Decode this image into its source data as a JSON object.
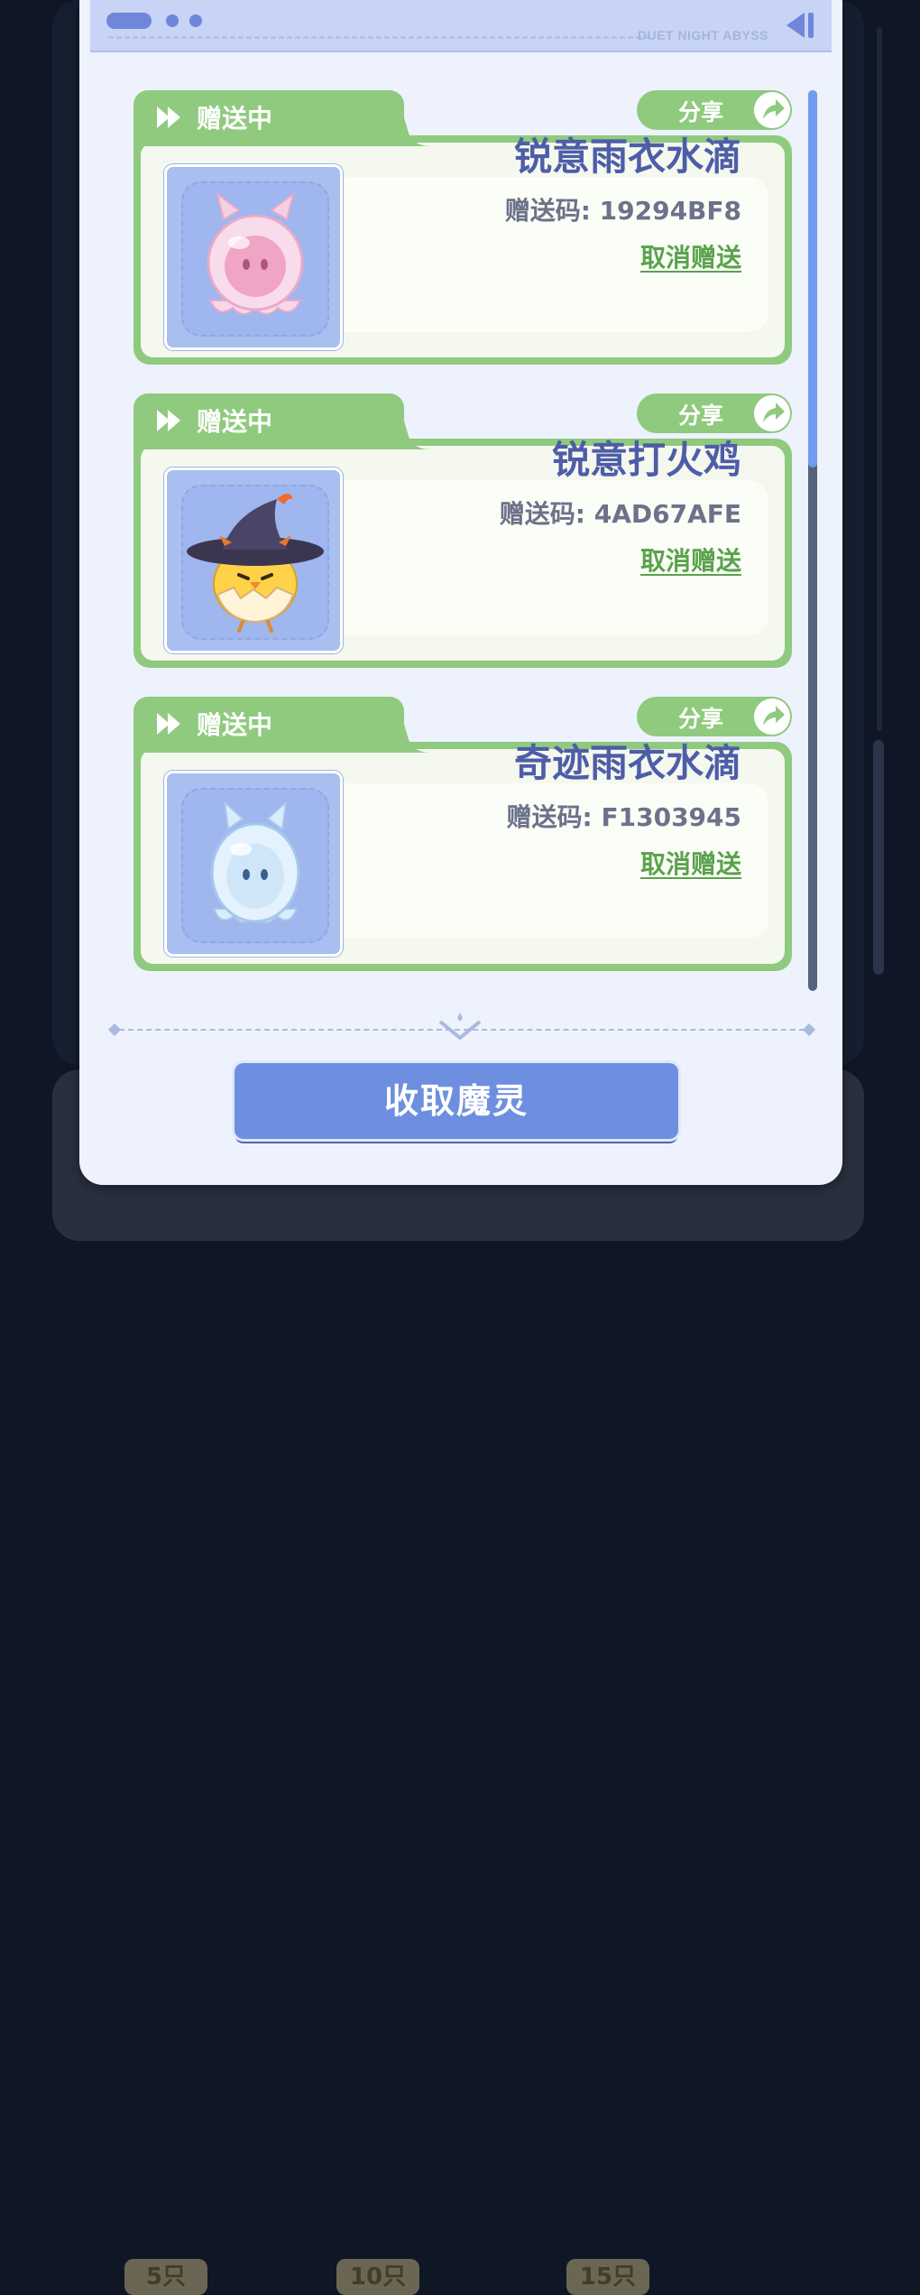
{
  "header": {
    "brand": "DUET NIGHT ABYSS"
  },
  "gifts": [
    {
      "status": "赠送中",
      "share_label": "分享",
      "name": "锐意雨衣水滴",
      "code_text": "赠送码: 19294BF8",
      "cancel_label": "取消赠送",
      "creature": "pink-raincoat-droplet"
    },
    {
      "status": "赠送中",
      "share_label": "分享",
      "name": "锐意打火鸡",
      "code_text": "赠送码: 4AD67AFE",
      "cancel_label": "取消赠送",
      "creature": "chick-with-witch-hat"
    },
    {
      "status": "赠送中",
      "share_label": "分享",
      "name": "奇迹雨衣水滴",
      "code_text": "赠送码: F1303945",
      "cancel_label": "取消赠送",
      "creature": "blue-raincoat-droplet"
    }
  ],
  "collect_button": "收取魔灵",
  "background_tiers": [
    "5只",
    "10只",
    "15只"
  ],
  "colors": {
    "accent_green": "#8fca7f",
    "accent_blue": "#6e8fe0",
    "name_text": "#4e5da8"
  }
}
